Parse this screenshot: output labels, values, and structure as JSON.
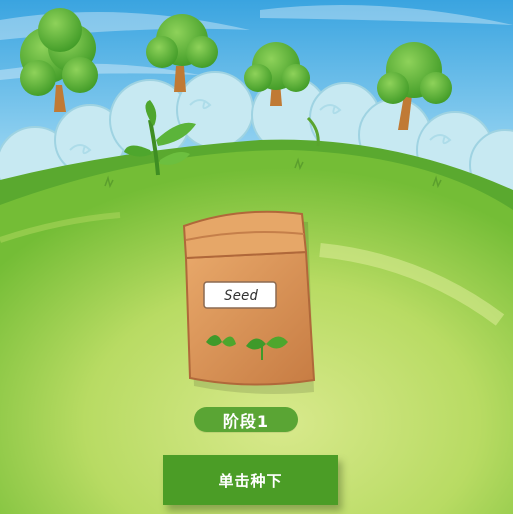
{
  "seed_bag": {
    "label": "Seed"
  },
  "stage": {
    "label": "阶段1"
  },
  "actions": {
    "plant_label": "单击种下"
  },
  "colors": {
    "sky": "#5fb8e6",
    "grass_light": "#cfe37a",
    "grass_dark": "#58ad2b",
    "button": "#4b9d26",
    "badge": "#5aa534",
    "bag": "#d9925a"
  }
}
